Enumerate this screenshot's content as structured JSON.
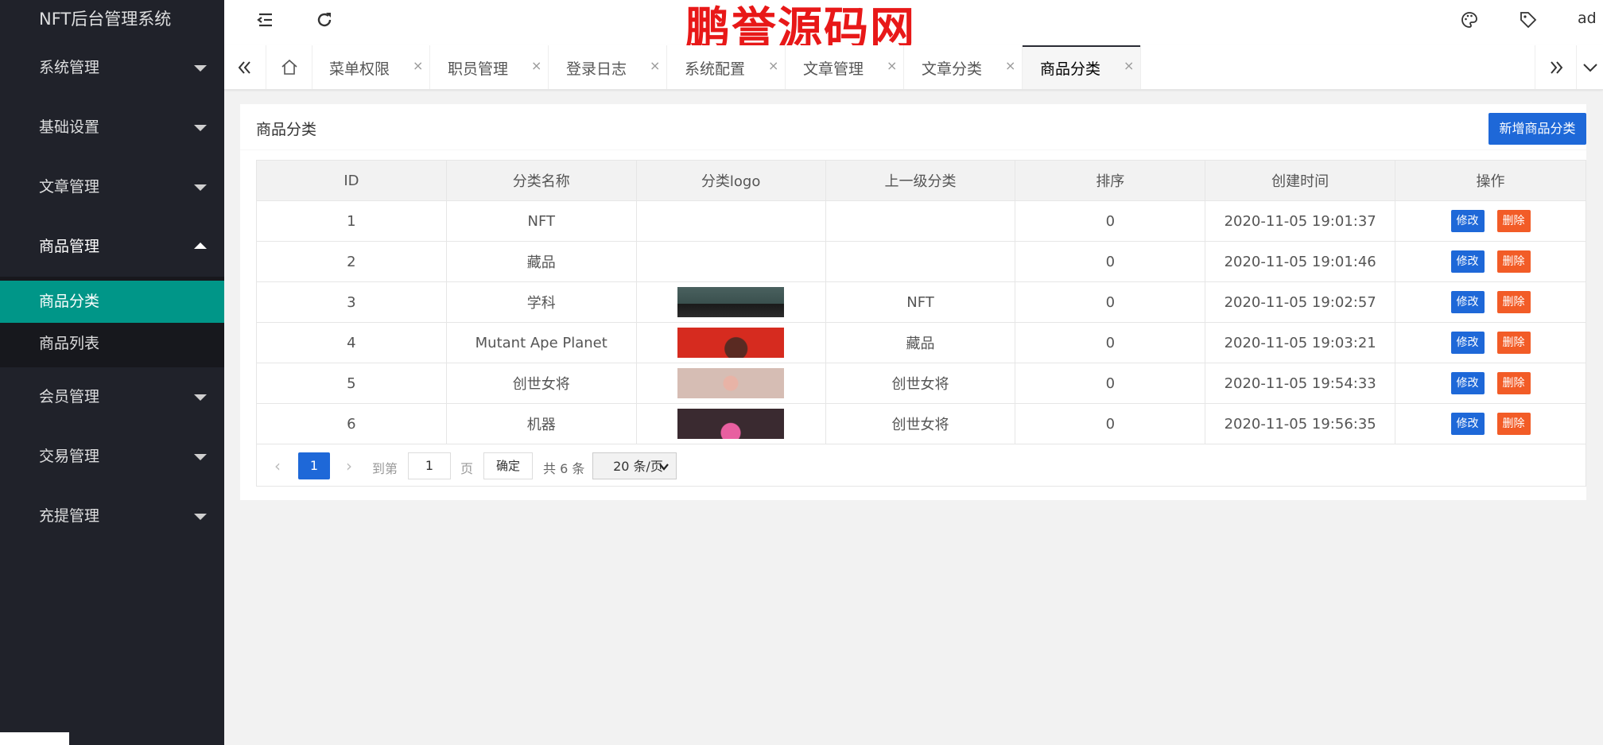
{
  "app": {
    "title": "NFT后台管理系统"
  },
  "header": {
    "watermark": "鹏誉源码网",
    "user": "ad"
  },
  "sidebar": {
    "items": [
      {
        "label": "系统管理"
      },
      {
        "label": "基础设置"
      },
      {
        "label": "文章管理"
      },
      {
        "label": "商品管理",
        "open": true,
        "children": [
          {
            "label": "商品分类",
            "active": true
          },
          {
            "label": "商品列表"
          }
        ]
      },
      {
        "label": "会员管理"
      },
      {
        "label": "交易管理"
      },
      {
        "label": "充提管理"
      }
    ]
  },
  "tabs": [
    {
      "label": "菜单权限"
    },
    {
      "label": "职员管理"
    },
    {
      "label": "登录日志"
    },
    {
      "label": "系统配置"
    },
    {
      "label": "文章管理"
    },
    {
      "label": "文章分类"
    },
    {
      "label": "商品分类",
      "active": true
    }
  ],
  "tab_close_glyph": "×",
  "card": {
    "title": "商品分类",
    "add_button": "新增商品分类"
  },
  "table": {
    "columns": [
      "ID",
      "分类名称",
      "分类logo",
      "上一级分类",
      "排序",
      "创建时间",
      "操作"
    ],
    "rows": [
      {
        "id": "1",
        "name": "NFT",
        "logo": "",
        "parent": "",
        "sort": "0",
        "created": "2020-11-05 19:01:37"
      },
      {
        "id": "2",
        "name": "藏品",
        "logo": "",
        "parent": "",
        "sort": "0",
        "created": "2020-11-05 19:01:46"
      },
      {
        "id": "3",
        "name": "学科",
        "logo": "image",
        "parent": "NFT",
        "sort": "0",
        "created": "2020-11-05 19:02:57"
      },
      {
        "id": "4",
        "name": "Mutant Ape Planet",
        "logo": "image",
        "parent": "藏品",
        "sort": "0",
        "created": "2020-11-05 19:03:21"
      },
      {
        "id": "5",
        "name": "创世女将",
        "logo": "image",
        "parent": "创世女将",
        "sort": "0",
        "created": "2020-11-05 19:54:33"
      },
      {
        "id": "6",
        "name": "机器",
        "logo": "image",
        "parent": "创世女将",
        "sort": "0",
        "created": "2020-11-05 19:56:35"
      }
    ],
    "edit_label": "修改",
    "delete_label": "删除"
  },
  "pagination": {
    "current": "1",
    "goto_label": "到第",
    "goto_value": "1",
    "page_label": "页",
    "confirm_label": "确定",
    "total_label": "共 6 条",
    "page_size": "20 条/页"
  },
  "colors": {
    "sidebar_bg": "#20222a",
    "active": "#009688",
    "primary": "#1e68d8",
    "danger": "#f25c27",
    "watermark": "#e81818"
  }
}
